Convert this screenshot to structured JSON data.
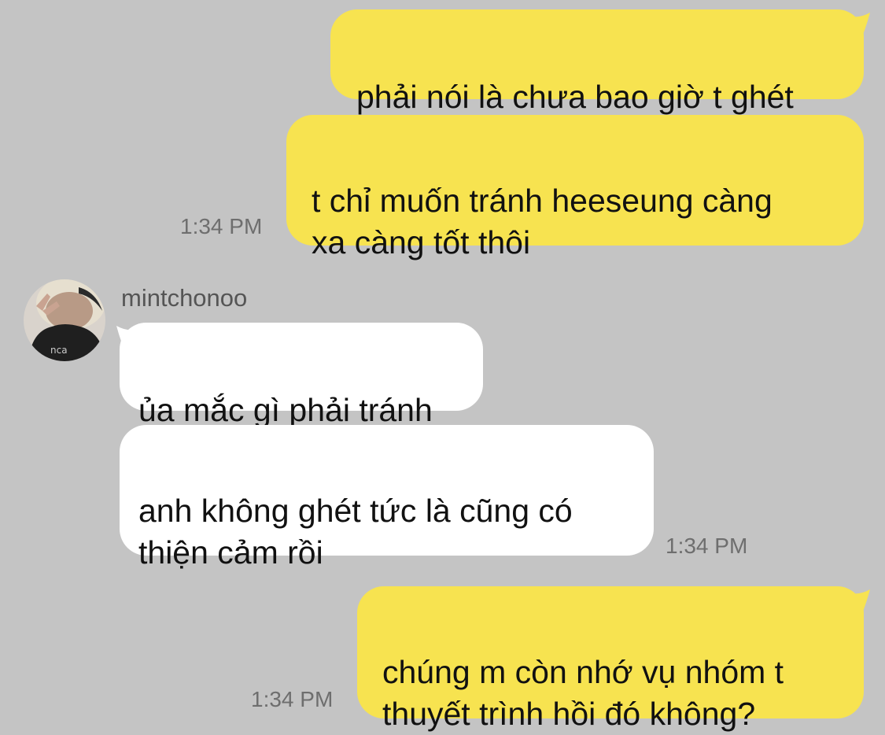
{
  "colors": {
    "background": "#c4c4c4",
    "my_bubble": "#f7e350",
    "their_bubble": "#ffffff",
    "timestamp": "#6e6e6e"
  },
  "contact": {
    "name": "mintchonoo",
    "avatar_icon": "profile-photo-icon"
  },
  "messages": [
    {
      "from": "me",
      "text": "phải nói là chưa bao giờ t ghét"
    },
    {
      "from": "me",
      "text": "t chỉ muốn tránh heeseung càng\nxa càng tốt thôi",
      "time": "1:34 PM"
    },
    {
      "from": "mintchonoo",
      "text": "ủa mắc gì phải tránh"
    },
    {
      "from": "mintchonoo",
      "text": "anh không ghét tức là cũng có\nthiện cảm rồi",
      "time": "1:34 PM"
    },
    {
      "from": "me",
      "text": "chúng m còn nhớ vụ nhóm t\nthuyết trình hồi đó không?",
      "time": "1:34 PM"
    }
  ]
}
